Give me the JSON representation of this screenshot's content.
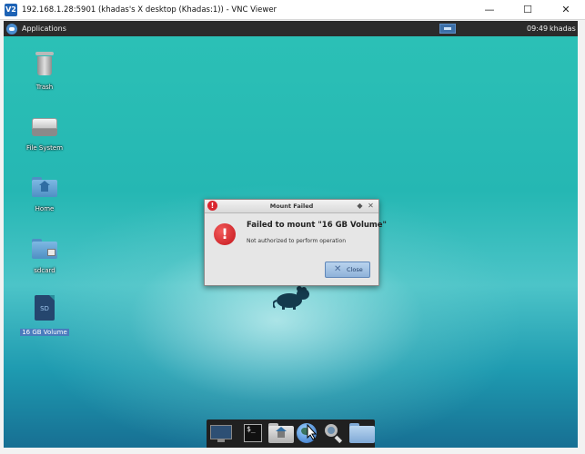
{
  "vnc_window": {
    "title": "192.168.1.28:5901 (khadas's X desktop (Khadas:1)) - VNC Viewer",
    "app_icon_text": "V2",
    "minimize_glyph": "—",
    "maximize_glyph": "☐",
    "close_glyph": "✕"
  },
  "panel": {
    "applications_label": "Applications",
    "clock": "09:49",
    "user": "khadas"
  },
  "desktop_icons": [
    {
      "label": "Trash",
      "icon": "trash-icon"
    },
    {
      "label": "File System",
      "icon": "drive-icon"
    },
    {
      "label": "Home",
      "icon": "home-folder-icon"
    },
    {
      "label": "sdcard",
      "icon": "locked-folder-icon"
    },
    {
      "label": "16 GB Volume",
      "icon": "sd-card-icon",
      "selected": true
    }
  ],
  "sd_card_text": "SD",
  "dialog": {
    "title": "Mount Failed",
    "heading": "Failed to mount \"16 GB Volume\"",
    "message": "Not authorized to perform operation",
    "close_button": "Close",
    "title_icon_glyph": "!",
    "error_glyph": "!",
    "shade_glyph": "◆",
    "close_glyph": "✕"
  },
  "dock": {
    "terminal_glyph": "$_",
    "items": [
      "screen-icon",
      "terminal-icon",
      "home-folder-icon",
      "web-browser-icon",
      "search-icon",
      "folder-icon"
    ]
  },
  "colors": {
    "desktop_teal": "#2cc1b6",
    "panel_bg": "#2b2b2b",
    "error_red": "#c4161c",
    "selection_blue": "#4a7bbd"
  }
}
